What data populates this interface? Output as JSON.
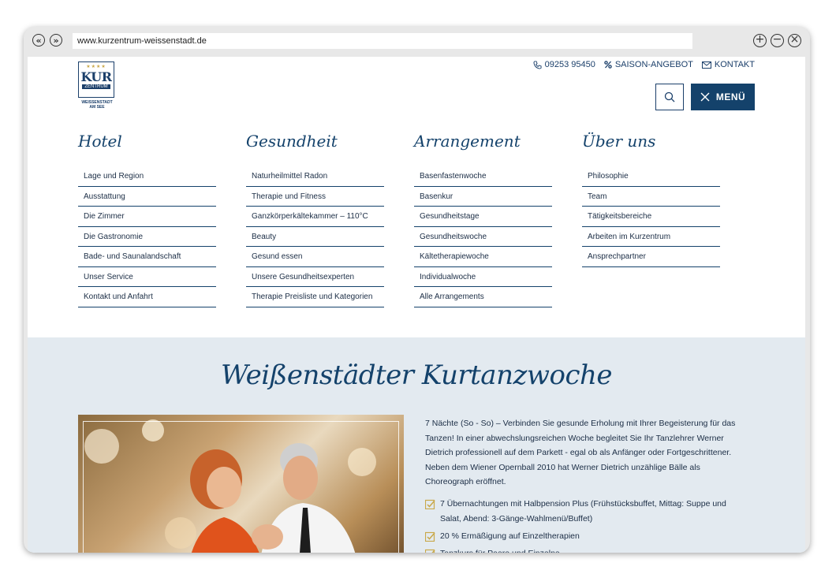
{
  "browser": {
    "url": "www.kurzentrum-weissenstadt.de",
    "back_icon": "«",
    "forward_icon": "»",
    "zoom_in_icon": "+",
    "zoom_out_icon": "−",
    "close_icon": "×"
  },
  "header": {
    "logo": {
      "stars": "★★★★",
      "kur": "KUR",
      "zentrum": "ZENTRUM",
      "sub1": "WEISSENSTADT",
      "sub2": "AM SEE"
    },
    "phone": "09253 95450",
    "offer": "SAISON-ANGEBOT",
    "contact": "KONTAKT",
    "menu_label": "MENÜ"
  },
  "menu": [
    {
      "title": "Hotel",
      "items": [
        "Lage und Region",
        "Ausstattung",
        "Die Zimmer",
        "Die Gastronomie",
        "Bade- und Saunalandschaft",
        "Unser Service",
        "Kontakt und Anfahrt"
      ]
    },
    {
      "title": "Gesundheit",
      "items": [
        "Naturheilmittel Radon",
        "Therapie und Fitness",
        "Ganzkörperkältekammer – 110°C",
        "Beauty",
        "Gesund essen",
        "Unsere Gesundheitsexperten",
        "Therapie Preisliste und Kategorien"
      ]
    },
    {
      "title": "Arrangement",
      "items": [
        "Basenfastenwoche",
        "Basenkur",
        "Gesundheitstage",
        "Gesundheitswoche",
        "Kältetherapiewoche",
        "Individualwoche",
        "Alle Arrangements"
      ]
    },
    {
      "title": "Über uns",
      "items": [
        "Philosophie",
        "Team",
        "Tätigkeitsbereiche",
        "Arbeiten im Kurzentrum",
        "Ansprechpartner"
      ]
    }
  ],
  "main": {
    "title": "Weißenstädter Kurtanzwoche",
    "description": "7 Nächte (So - So) – Verbinden Sie gesunde Erholung mit Ihrer Begeisterung für das Tanzen! In einer abwechslungsreichen Woche begleitet Sie Ihr Tanzlehrer Werner Dietrich professionell auf dem Parkett - egal ob als Anfänger oder Fortgeschrittener. Neben dem Wiener Opernball 2010 hat Werner Dietrich unzählige Bälle als Choreograph eröffnet.",
    "checks": [
      "7 Übernachtungen mit Halbpension Plus (Frühstücksbuffet, Mittag: Suppe und Salat, Abend: 3-Gänge-Wahlmenü/Buffet)",
      "20 % Ermäßigung auf Einzeltherapien",
      "Tanzkurs für Paare und Einzelne"
    ]
  },
  "colors": {
    "brand": "#14426b",
    "accent": "#c9a84a",
    "section_bg": "#e3eaf0"
  }
}
